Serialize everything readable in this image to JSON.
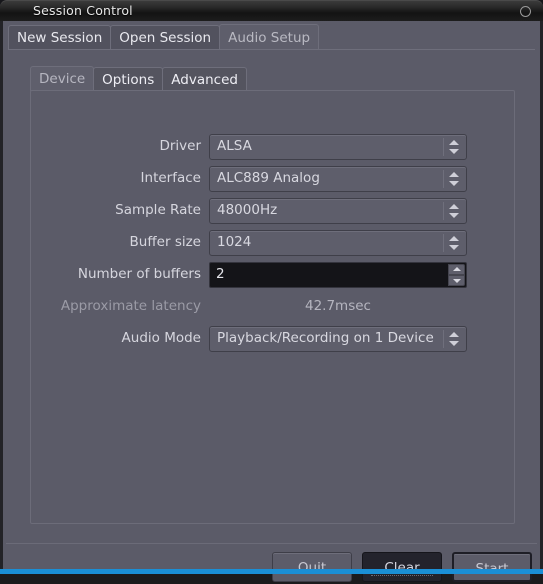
{
  "window": {
    "title": "Session Control",
    "close_icon": "circle-icon"
  },
  "outer_tabs": [
    {
      "label": "New Session",
      "active": false
    },
    {
      "label": "Open Session",
      "active": false
    },
    {
      "label": "Audio Setup",
      "active": true
    }
  ],
  "inner_tabs": [
    {
      "label": "Device",
      "active": true
    },
    {
      "label": "Options",
      "active": false
    },
    {
      "label": "Advanced",
      "active": false
    }
  ],
  "form": {
    "driver": {
      "label": "Driver",
      "value": "ALSA"
    },
    "interface": {
      "label": "Interface",
      "value": "ALC889 Analog"
    },
    "sample_rate": {
      "label": "Sample Rate",
      "value": "48000Hz"
    },
    "buffer_size": {
      "label": "Buffer size",
      "value": "1024"
    },
    "number_of_buffers": {
      "label": "Number of buffers",
      "value": "2"
    },
    "approximate_latency": {
      "label": "Approximate latency",
      "value": "42.7msec"
    },
    "audio_mode": {
      "label": "Audio Mode",
      "value": "Playback/Recording on 1 Device"
    }
  },
  "actions": {
    "quit": {
      "mnemonic": "Q",
      "rest": "uit"
    },
    "clear": {
      "mnemonic": "C",
      "rest": "lear"
    },
    "start": {
      "label": "Start"
    }
  },
  "colors": {
    "dialog_bg": "#5b5b68",
    "titlebar_bg": "#1d1d1d",
    "entry_bg": "#141418",
    "accent_blue": "#1a8fd6",
    "text": "#d6d6de",
    "text_dim": "#9b9ba6"
  }
}
